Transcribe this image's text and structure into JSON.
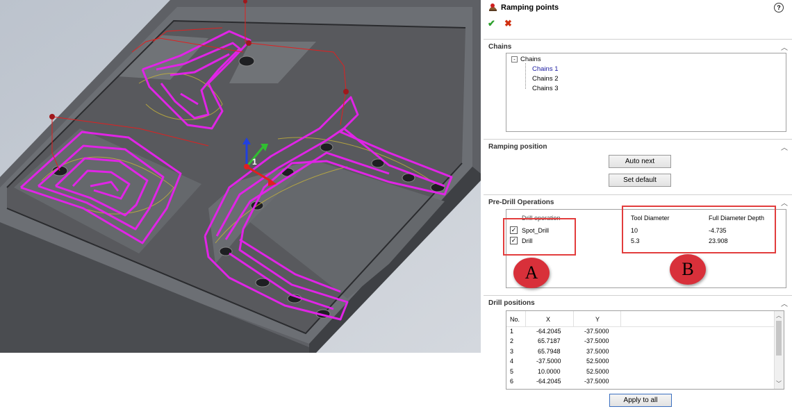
{
  "panel": {
    "title": "Ramping points",
    "help_icon": "question-circle-icon",
    "ok_icon": "green-check-icon",
    "cancel_icon": "red-x-icon"
  },
  "chains": {
    "section_title": "Chains",
    "root": "Chains",
    "items": [
      "Chains 1",
      "Chains 2",
      "Chains 3"
    ]
  },
  "ramping": {
    "section_title": "Ramping position",
    "auto_next": "Auto next",
    "set_default": "Set default"
  },
  "predrill": {
    "section_title": "Pre-Drill Operations",
    "col_operation": "Drill operation",
    "col_tool_diameter": "Tool Diameter",
    "col_full_depth": "Full Diameter Depth",
    "rows": [
      {
        "name": "Spot_Drill",
        "checked": true,
        "tool_diameter": "10",
        "depth": "-4.735"
      },
      {
        "name": "Drill",
        "checked": true,
        "tool_diameter": "5.3",
        "depth": "23.908"
      }
    ],
    "badge_a": "A",
    "badge_b": "B"
  },
  "drill_positions": {
    "section_title": "Drill positions",
    "headers": [
      "No.",
      "X",
      "Y"
    ],
    "rows": [
      [
        "1",
        "-64.2045",
        "-37.5000"
      ],
      [
        "2",
        "65.7187",
        "-37.5000"
      ],
      [
        "3",
        "65.7948",
        "37.5000"
      ],
      [
        "4",
        "-37.5000",
        "52.5000"
      ],
      [
        "5",
        "10.0000",
        "52.5000"
      ],
      [
        "6",
        "-64.2045",
        "-37.5000"
      ]
    ],
    "apply_label": "Apply to all"
  },
  "viewport": {
    "axis_label": "1"
  }
}
